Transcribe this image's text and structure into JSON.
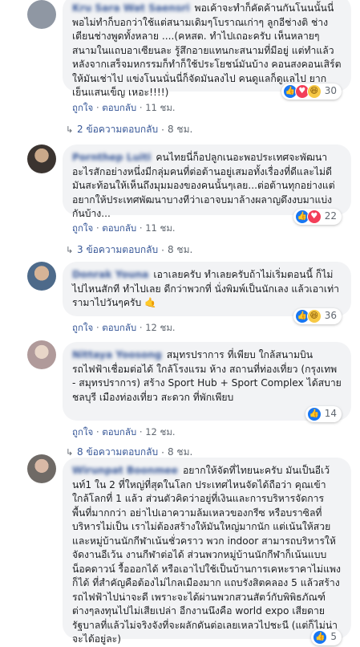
{
  "comments": [
    {
      "author": "Kru Sara Wat Saensri",
      "text": "พอเค้าจะทำก็คัดค้านกันโนนนั้นนี่ พอไม่ทำก็บอกว่าใช้แต่สนามเดิมๆโบราณเก่าๆ ลูกอีช่างติ ช่างเตียนช่างพูดทั้งหลาย ....(คหสต. ทำไปเถอะครับ เห็นหลายๆสนามในแถบอาเซียนละ รู้สึกอายแทนกะสนามที่มีอยู่ แต่ทำแล้วหลังจากเสร็จมหกรรมก็ทำก็ใช้ประโยชน์มันบ้าง คอนสงคอนเสิร์ตให้มันเช่าไป แข่งโนนนั่นนี่ก็จัดมันลงไป คนดูแลก็ดูแลไป ยากเย็นแสนเข็ญ เหอะ!!!!)",
      "reactions": {
        "icons": [
          "like-icon",
          "love-icon",
          "haha-icon"
        ],
        "count": "30"
      },
      "like": "ถูกใจ",
      "reply": "ตอบกลับ",
      "time": "11 ชม.",
      "replies_label": "2 ข้อความตอบกลับ",
      "replies_time": "8 ชม."
    },
    {
      "author": "Pornthep Luiti",
      "text": "คนไทยนี่ก็อปลูกเนอะพอประเทศจะพัฒนาอะไรสักอย่างหนึ่งมีกลุ่มคนที่ต่อต้านอยู่เสมอทั้งเรื่องที่ดีและไม่ดีมันสะท้อนให้เห็นถึงมุมมองของคนนั้นๆเลย...ต่อต้านทุกอย่างแต่อยากให้ประเทศพัฒนาบางทีว่าเอาจบมาล้างผลาญดึงงบมาแบ่งกันบ้าง...",
      "reactions": {
        "icons": [
          "like-icon",
          "love-icon"
        ],
        "count": "22"
      },
      "like": "ถูกใจ",
      "reply": "ตอบกลับ",
      "time": "11 ชม.",
      "replies_label": "3 ข้อความตอบกลับ",
      "replies_time": "8 ชม."
    },
    {
      "author": "Donrak Youna",
      "text": "เอาเลยครับ ทำเลยครับถ้าไม่เริ่มตอนนี้ ก็ไม่ไปไหนสักที ทำไปเลย ดีกว่าพวกที่ นั่งพิมพ์เป็นนักเลง แล้วเอาเท่ารามาไปวันๆครับ 🤙",
      "reactions": {
        "icons": [
          "like-icon",
          "haha-icon"
        ],
        "count": "36"
      },
      "like": "ถูกใจ",
      "reply": "ตอบกลับ",
      "time": "12 ชม.",
      "replies_label": "",
      "replies_time": ""
    },
    {
      "author": "Nittaya Yoosong",
      "text": "สมุทรปราการ ที่เพียบ ใกล้สนามบินรถไฟฟ้าเชื่อมต่อได้ ใกล้โรงแรม ห้าง สถานที่ท่องเที่ยว (กรุงเทพ - สมุทรปราการ) สร้าง Sport Hub + Sport Complex ได้สบาย\nชลบุรี เมืองท่องเที่ยว สะดวก ที่พักเพียบ",
      "reactions": {
        "icons": [
          "like-icon"
        ],
        "count": "14"
      },
      "like": "ถูกใจ",
      "reply": "ตอบกลับ",
      "time": "12 ชม.",
      "replies_label": "8 ข้อความตอบกลับ",
      "replies_time": "8 ชม."
    },
    {
      "author": "Wirunpat Boonmee",
      "text": "อยากให้จัดที่ไทยนะครับ มันเป็นอีเว้นท์1 ใน 2 ที่ใหญ่ที่สุดในโลก ประเทศไหนจัดได้ถือว่า คุณเข้าใกล้โลกที่ 1 แล้ว ส่วนตัวคิดว่าอยู่ที่เงินและการบริหารจัดการพื้นที่มากกว่า อย่าไปเอาความล้มเหลวของกรีซ หรือบราซิลที่บริหารไม่เป็น เราไม่ต้องสร้างให้มันใหญ่มากนัก แต่เน้นให้สวย และหมู่บ้านนักกีฬาเน้นชั่วคราว พวก indoor สามารถบริหารให้จัดงานอีเว้น งานกีฬาต่อได้ ส่วนพวกหมู่บ้านนักกีฬาก็เน้นแบบน็อคดาวน์ รื้อออกได้ หรือเอาไปใช้เป็นบ้านการเคหะราคาไม่แพงก็ได้ ที่สำคัญคือต้องไม่ไกลเมืองมาก แถบรังสิตคลอง 5 แล้วสร้างรถไฟฟ้าไปน่าจะดี เพราะจะได้ผ่านพวกสวนสัตว์กับพิพิธภัณฑ์ต่างๆลงทุนไปไม่เสียเปล่า อีกงานนึงคือ world expo เสียดายรัฐบาลที่แล้วไม่จริงจังที่จะผลักดันต่อเลยเหลวไปชะนี (แต่ก็ไม่น่าจะได้อยู่ละ)",
      "reactions": {
        "icons": [
          "like-icon"
        ],
        "count": "5"
      },
      "like": "",
      "reply": "",
      "time": "",
      "replies_label": "",
      "replies_time": ""
    }
  ],
  "sep": "·"
}
